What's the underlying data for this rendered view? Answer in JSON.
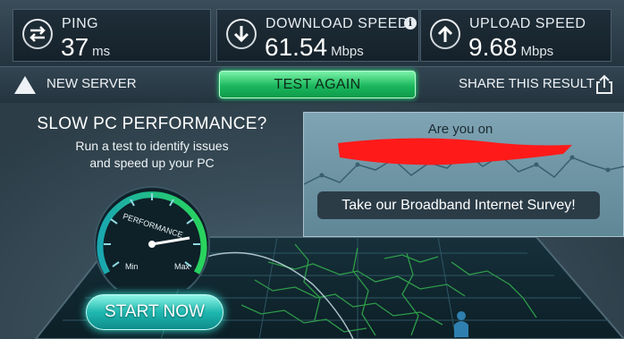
{
  "stats": {
    "ping": {
      "label": "PING",
      "value": "37",
      "unit": "ms"
    },
    "download": {
      "label": "DOWNLOAD SPEED",
      "value": "61.54",
      "unit": "Mbps",
      "info": "i"
    },
    "upload": {
      "label": "UPLOAD SPEED",
      "value": "9.68",
      "unit": "Mbps"
    }
  },
  "actions": {
    "new_server": "NEW SERVER",
    "test_again": "TEST AGAIN",
    "share": "SHARE THIS RESULT"
  },
  "promo": {
    "title": "SLOW PC PERFORMANCE?",
    "subtitle_line1": "Run a test to identify issues",
    "subtitle_line2": "and speed up your PC",
    "gauge_label": "PERFORMANCE",
    "gauge_min": "Min",
    "gauge_max": "Max",
    "start_label": "START NOW"
  },
  "survey": {
    "question": "Are you on",
    "button": "Take our Broadband Internet Survey!"
  },
  "colors": {
    "accent_green": "#1cb85e",
    "accent_teal": "#1fb8b0",
    "redaction": "#ff1a1a"
  },
  "icons": {
    "ping": "ping-arrows-icon",
    "download": "download-arrow-icon",
    "upload": "upload-arrow-icon",
    "new_server": "triangle-icon",
    "share": "share-icon"
  }
}
